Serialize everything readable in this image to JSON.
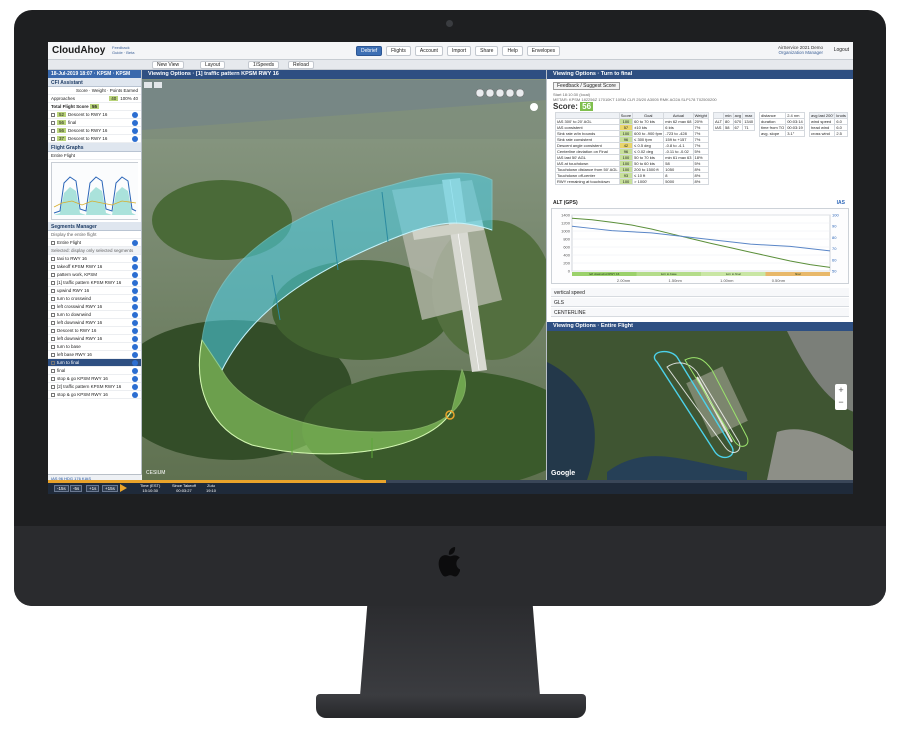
{
  "app": {
    "brand": "CloudAhoy",
    "brand_links": [
      "Feedback",
      "Guide",
      "Beta"
    ],
    "nav": [
      "Debrief",
      "Flights",
      "Account",
      "Import",
      "Share",
      "Help",
      "Envelopes"
    ],
    "active_nav": "Debrief",
    "user_line1": "AirService 2021 Demo",
    "user_line2": "Organization Manager",
    "logout": "Logout"
  },
  "toolbar": {
    "new_view": "New View",
    "layout": "Layout",
    "speeds": "1\\Speeds",
    "reload": "Reload"
  },
  "left": {
    "flight_header": "18-Jul-2019 18:07 · KPSM · KPSM",
    "cfi_title": "CFI Assistant",
    "cols": [
      "Score",
      "Weight",
      "Points Earned"
    ],
    "approaches_label": "Approaches",
    "approaches_vals": [
      "40",
      "100%",
      "40"
    ],
    "total_label": "Total Flight Score",
    "total_val": "55",
    "score_rows": [
      {
        "badge": "52",
        "label": "Descent to RWY 16"
      },
      {
        "badge": "56",
        "label": "final"
      },
      {
        "badge": "56",
        "label": "Descent to RWY 16"
      },
      {
        "badge": "37",
        "label": "Descent to RWY 16"
      }
    ],
    "graphs_title": "Flight Graphs",
    "graphs_sub": "Entire Flight",
    "segments_title": "Segments Manager",
    "segments_hint": "Display the entire flight",
    "entire_flight": "Entire Flight",
    "segments_note": "Selected: display only selected segments",
    "segments": [
      {
        "label": "taxi to RWY 16",
        "sel": false
      },
      {
        "label": "takeoff KPSM RWY 16",
        "sel": false
      },
      {
        "label": "pattern work, KPSM",
        "sel": false
      },
      {
        "label": "[1] traffic pattern KPSM RWY 16",
        "sel": false
      },
      {
        "label": "upwind RWY 16",
        "sel": false
      },
      {
        "label": "turn to crosswind",
        "sel": false
      },
      {
        "label": "left crosswind RWY 16",
        "sel": false
      },
      {
        "label": "turn to downwind",
        "sel": false
      },
      {
        "label": "left downwind RWY 16",
        "sel": false
      },
      {
        "label": "Descent to RWY 16",
        "sel": false
      },
      {
        "label": "left downwind RWY 16",
        "sel": false
      },
      {
        "label": "turn to base",
        "sel": false
      },
      {
        "label": "left base RWY 16",
        "sel": false
      },
      {
        "label": "turn to final",
        "sel": true
      },
      {
        "label": "final",
        "sel": false
      },
      {
        "label": "stop & go KPSM RWY 16",
        "sel": false
      },
      {
        "label": "[2] traffic pattern KPSM RWY 16",
        "sel": false
      },
      {
        "label": "stop & go KPSM RWY 16",
        "sel": false
      }
    ],
    "stats_line1": "IAS  96   HDG  176   KIAS",
    "stats_line2": "GS   71   TRK  169   AGL",
    "stats_line3": "VS   -50  ALT  1,250  MSL"
  },
  "view3d": {
    "title": "[1] traffic pattern KPSM RWY 16",
    "tab": "Viewing Options",
    "credit": "CESIUM"
  },
  "analysis": {
    "tab": "Viewing Options",
    "title": "Turn to final",
    "feedback": "Feedback / Suggest Score",
    "meta1": "Start 18:10:30 (local)",
    "meta2": "METAR: KPSM 182256Z 17010KT 10SM CLR 25/20 A3005 RMK AO2A SLP178 T02500200",
    "score_label": "Score:",
    "score_val": "56",
    "table_head": [
      "",
      "Score",
      "Goal",
      "Actual",
      "Weight"
    ],
    "table_rows": [
      [
        "IAS 300' to 20' AGL",
        "100",
        "60 to 70 kts",
        "min 62 max 68",
        "20%"
      ],
      [
        "IAS consistent",
        "57",
        "±10 kts",
        "6 kts",
        "7%"
      ],
      [
        "Sink rate w/in bounds",
        "100",
        "600 to -900 fpm",
        "-723 to -428",
        "7%"
      ],
      [
        "Sink rate consistent",
        "96",
        "≤ 300 fpm",
        "159 to +157",
        "7%"
      ],
      [
        "Descent angle consistent",
        "42",
        "≤ 0.5 deg",
        "-0.8 to -4.1",
        "7%"
      ],
      [
        "Centerline deviation on Final",
        "96",
        "≤ 0.02 deg",
        "-0.11 to -0.02",
        "5%"
      ],
      [
        "IAS last 50' AGL",
        "100",
        "50 to 70 kts",
        "min 61 max 63",
        "18%"
      ],
      [
        "IAS at touchdown",
        "100",
        "50 to 60 kts",
        "58",
        "5%"
      ],
      [
        "Touchdown distance from 50' AGL",
        "100",
        "200 to 1500 ft",
        "1050",
        "8%"
      ],
      [
        "Touchdown off-center",
        "93",
        "≤ 10 ft",
        "8",
        "8%"
      ],
      [
        "RWY remaining at touchdown",
        "100",
        "> 1000'",
        "5000",
        "8%"
      ]
    ],
    "mini1_head": [
      "",
      "min",
      "avg",
      "max"
    ],
    "mini1_rows": [
      [
        "ALT",
        "80",
        "670",
        "1340"
      ],
      [
        "IAS",
        "58",
        "67",
        "71"
      ]
    ],
    "mini2_rows": [
      [
        "distance",
        "2.4 nm"
      ],
      [
        "duration",
        "00:03:14"
      ],
      [
        "time from TO",
        "00:03:19"
      ],
      [
        "avg. slope",
        "3.1°"
      ]
    ],
    "mini3_head": [
      "avg last 200'",
      "knots"
    ],
    "mini3_rows": [
      [
        "wind speed",
        "6.0"
      ],
      [
        "head wind",
        "6.0"
      ],
      [
        "cross wind",
        "2.5"
      ]
    ],
    "alt_label": "ALT (GPS)",
    "ias_label": "IAS",
    "collapse": [
      "vertical speed",
      "GLS",
      "CENTERLINE"
    ]
  },
  "chart_data": {
    "type": "line",
    "title": "",
    "ylabel": "ALT (GPS)",
    "y2label": "IAS",
    "x_ticks": [
      "2.00nm",
      "1.50nm",
      "1.00nm",
      "0.50nm"
    ],
    "y_ticks": [
      0,
      200,
      400,
      600,
      800,
      1000,
      1200,
      1400
    ],
    "y2_ticks": [
      50,
      60,
      70,
      80,
      90,
      100
    ],
    "ylim": [
      0,
      1400
    ],
    "y2lim": [
      50,
      100
    ],
    "segments": [
      "left downwind RWY 16",
      "turn to base",
      "turn to final",
      "final"
    ],
    "series": [
      {
        "name": "ALT",
        "color": "#5b8f3a",
        "values": [
          1320,
          1280,
          1220,
          1150,
          1050,
          930,
          810,
          690,
          580,
          470,
          360,
          250,
          160,
          90
        ]
      },
      {
        "name": "IAS",
        "color": "#5a86c7",
        "values": [
          90,
          88,
          86,
          85,
          84,
          82,
          80,
          78,
          76,
          74,
          73,
          72,
          70,
          68
        ]
      }
    ]
  },
  "map": {
    "tab": "Viewing Options",
    "title": "Entire Flight",
    "google": "Google",
    "zoom_in": "+",
    "zoom_out": "−"
  },
  "timeline": {
    "buttons": [
      "-15s",
      "-5s",
      "+1s",
      "+15s"
    ],
    "progress": 0.42,
    "time_label1": "Time (EST)",
    "time_val1": "15:10:30",
    "time_label2": "Since Takeoff",
    "time_val2": "00:03:27",
    "time_label3": "Zulu",
    "time_val3": "19:10"
  },
  "colors": {
    "accent": "#2e4f82",
    "pattern_cyan": "#4cd2ea",
    "pattern_green": "#9be36c",
    "orange": "#e9a32b"
  }
}
